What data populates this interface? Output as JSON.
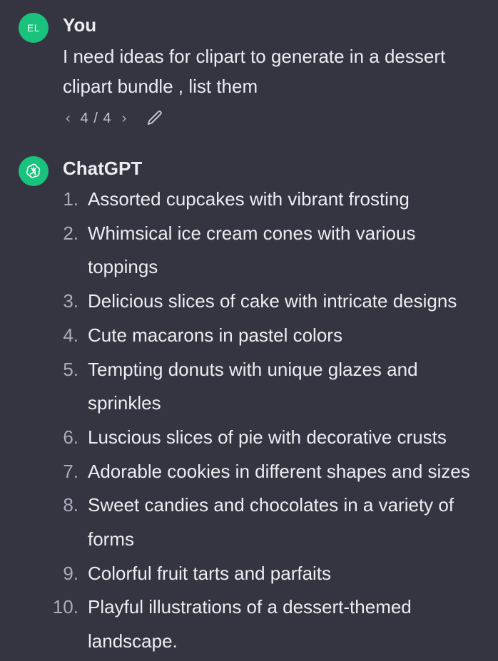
{
  "user_message": {
    "avatar_initials": "EL",
    "author": "You",
    "text": "I need ideas for clipart to generate in a dessert clipart bundle , list them",
    "pager": {
      "prev_icon": "chevron-left-icon",
      "next_icon": "chevron-right-icon",
      "count": "4 / 4",
      "edit_icon": "pencil-icon"
    }
  },
  "assistant_message": {
    "avatar_icon": "openai-logo-icon",
    "author": "ChatGPT",
    "items": [
      {
        "num": "1.",
        "text": "Assorted cupcakes with vibrant frosting"
      },
      {
        "num": "2.",
        "text": "Whimsical ice cream cones with various toppings"
      },
      {
        "num": "3.",
        "text": "Delicious slices of cake with intricate designs"
      },
      {
        "num": "4.",
        "text": "Cute macarons in pastel colors"
      },
      {
        "num": "5.",
        "text": "Tempting donuts with unique glazes and sprinkles"
      },
      {
        "num": "6.",
        "text": "Luscious slices of pie with decorative crusts"
      },
      {
        "num": "7.",
        "text": "Adorable cookies in different shapes and sizes"
      },
      {
        "num": "8.",
        "text": "Sweet candies and chocolates in a variety of forms"
      },
      {
        "num": "9.",
        "text": "Colorful fruit tarts and parfaits"
      },
      {
        "num": "10.",
        "text": "Playful illustrations of a dessert-themed landscape."
      }
    ]
  },
  "colors": {
    "background": "#343541",
    "avatar_green": "#19c37d",
    "text": "#ececf1",
    "muted": "#acacbe"
  }
}
